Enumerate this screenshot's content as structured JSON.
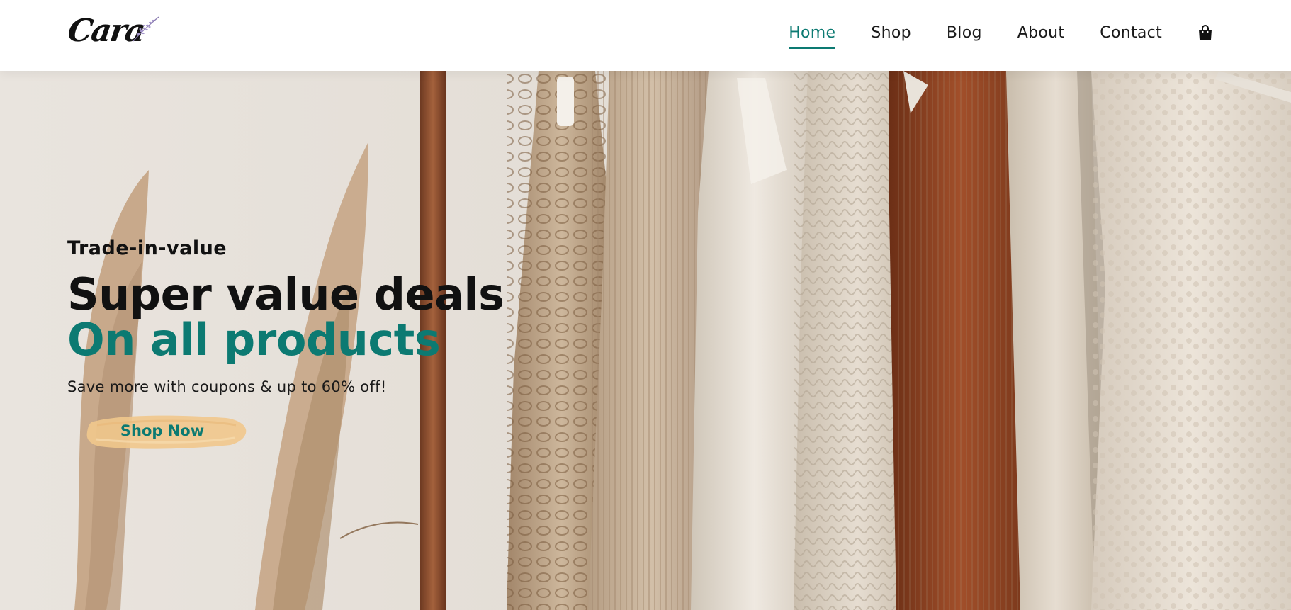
{
  "brand": {
    "logo_text": "Cara",
    "logo_icon": "lavender-sprig-icon"
  },
  "nav": {
    "items": [
      {
        "label": "Home",
        "active": true
      },
      {
        "label": "Shop",
        "active": false
      },
      {
        "label": "Blog",
        "active": false
      },
      {
        "label": "About",
        "active": false
      },
      {
        "label": "Contact",
        "active": false
      }
    ],
    "cart_icon": "shopping-bag-icon"
  },
  "hero": {
    "eyebrow": "Trade-in-value",
    "headline": "Super value deals",
    "headline_accent": "On all products",
    "subtext": "Save more with coupons & up to 60% off!",
    "cta_label": "Shop Now",
    "image": "clothing-rack-with-pampas-grass"
  },
  "colors": {
    "accent": "#0c7a72",
    "cta_brush": "#f2c98a",
    "text": "#111111",
    "background": "#ffffff"
  }
}
